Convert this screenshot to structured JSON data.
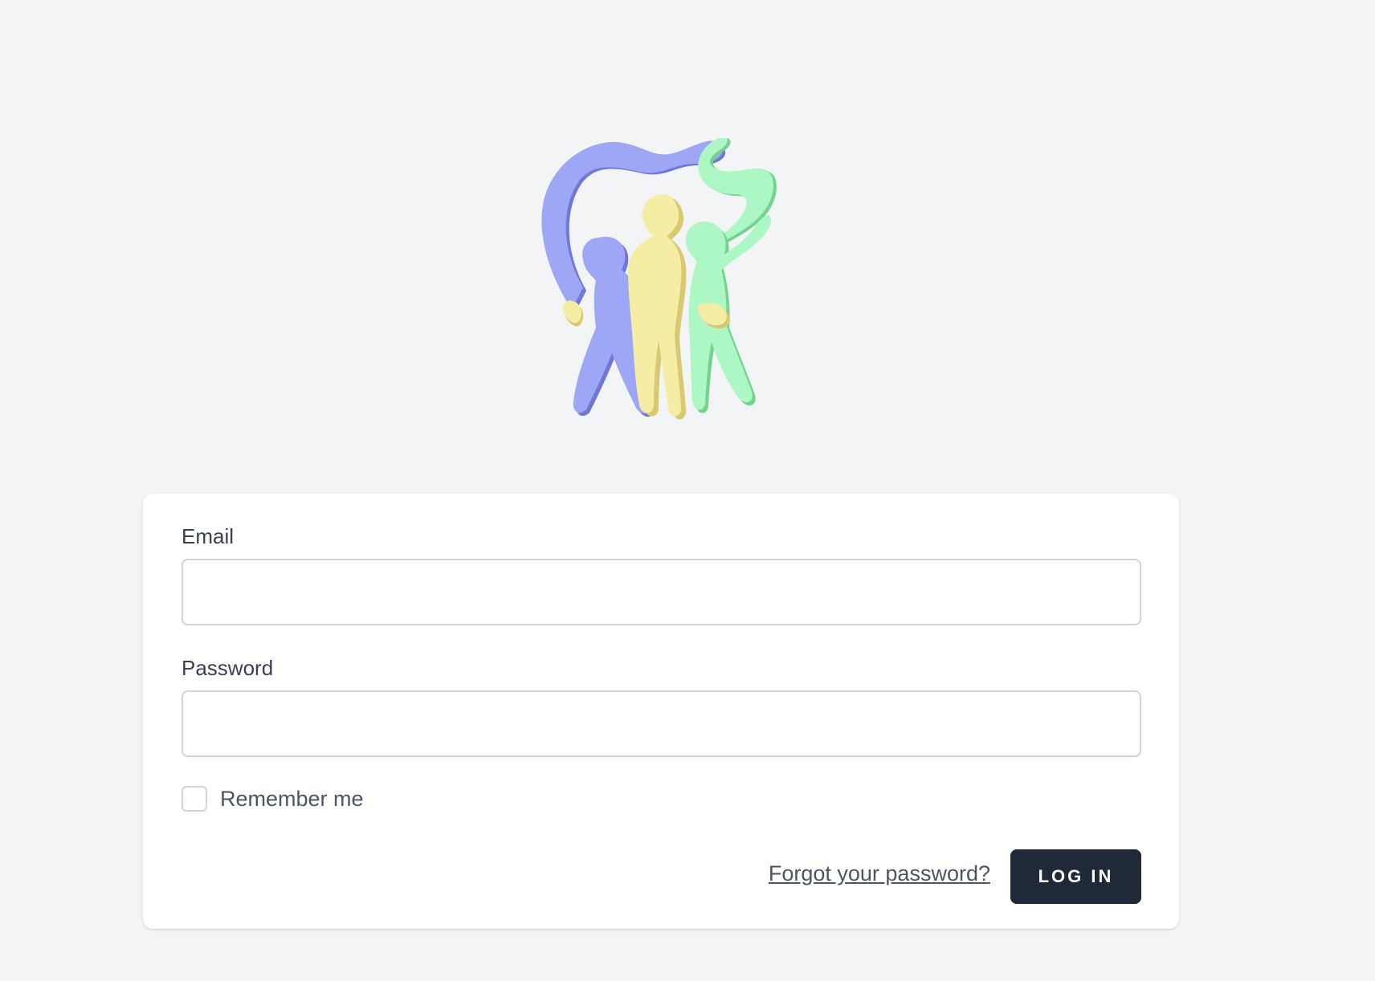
{
  "logo": {
    "icon": "family-logo-icon",
    "colors": {
      "purple": "#9ea7f5",
      "purple_shadow": "#6f78d4",
      "yellow": "#f6eda4",
      "yellow_shadow": "#d8c971",
      "green": "#adf7c4",
      "green_shadow": "#74d48f"
    }
  },
  "form": {
    "email_label": "Email",
    "email_value": "",
    "password_label": "Password",
    "password_value": "",
    "remember_label": "Remember me",
    "remember_checked": false,
    "forgot_link": "Forgot your password?",
    "login_button": "LOG IN"
  },
  "colors": {
    "page_background": "#f3f4f6",
    "card_background": "#ffffff",
    "button_background": "#1f2937"
  }
}
